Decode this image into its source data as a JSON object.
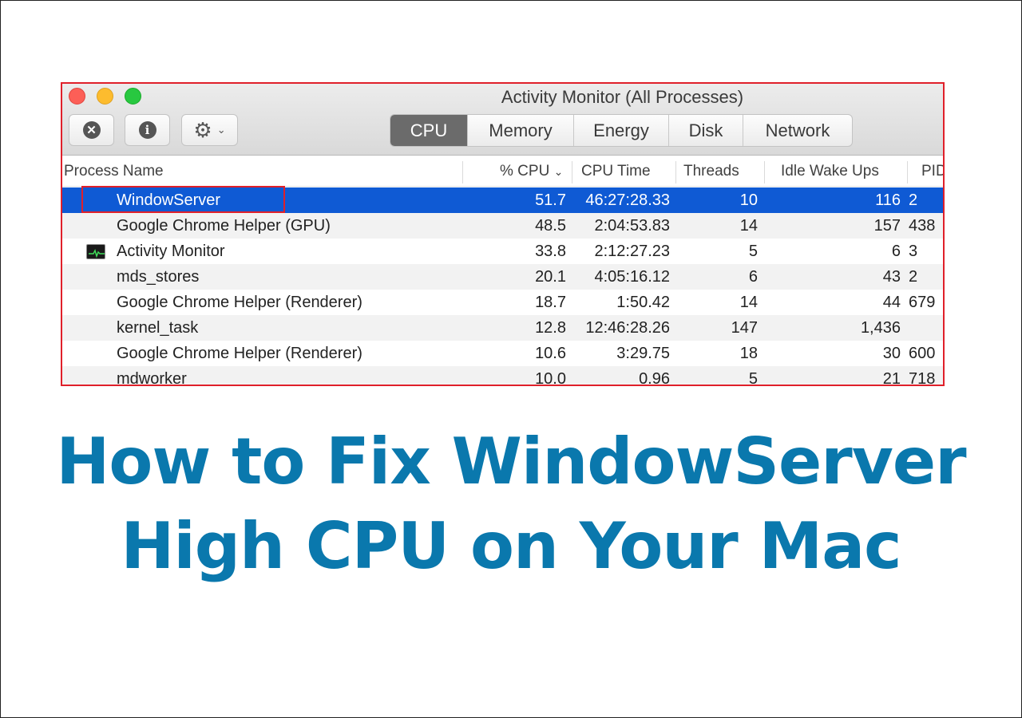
{
  "window": {
    "title": "Activity Monitor (All Processes)",
    "toolbar": {
      "stop_icon": "x-circle-icon",
      "info_icon": "info-icon",
      "gear_icon": "gear-icon",
      "tabs": [
        {
          "label": "CPU",
          "active": true
        },
        {
          "label": "Memory",
          "active": false
        },
        {
          "label": "Energy",
          "active": false
        },
        {
          "label": "Disk",
          "active": false
        },
        {
          "label": "Network",
          "active": false
        }
      ]
    },
    "columns": {
      "name": "Process Name",
      "cpu": "% CPU",
      "cpu_time": "CPU Time",
      "threads": "Threads",
      "idle": "Idle Wake Ups",
      "pid": "PID"
    },
    "rows": [
      {
        "name": "WindowServer",
        "cpu": "51.7",
        "time": "46:27:28.33",
        "threads": "10",
        "idle": "116",
        "pid": "2"
      },
      {
        "name": "Google Chrome Helper (GPU)",
        "cpu": "48.5",
        "time": "2:04:53.83",
        "threads": "14",
        "idle": "157",
        "pid": "438"
      },
      {
        "name": "Activity Monitor",
        "cpu": "33.8",
        "time": "2:12:27.23",
        "threads": "5",
        "idle": "6",
        "pid": "3"
      },
      {
        "name": "mds_stores",
        "cpu": "20.1",
        "time": "4:05:16.12",
        "threads": "6",
        "idle": "43",
        "pid": "2"
      },
      {
        "name": "Google Chrome Helper (Renderer)",
        "cpu": "18.7",
        "time": "1:50.42",
        "threads": "14",
        "idle": "44",
        "pid": "679"
      },
      {
        "name": "kernel_task",
        "cpu": "12.8",
        "time": "12:46:28.26",
        "threads": "147",
        "idle": "1,436",
        "pid": ""
      },
      {
        "name": "Google Chrome Helper (Renderer)",
        "cpu": "10.6",
        "time": "3:29.75",
        "threads": "18",
        "idle": "30",
        "pid": "600"
      },
      {
        "name": "mdworker",
        "cpu": "10.0",
        "time": "0.96",
        "threads": "5",
        "idle": "21",
        "pid": "718"
      }
    ],
    "selected_row": 0
  },
  "headline": {
    "line1": "How to Fix WindowServer",
    "line2": "High CPU on Your Mac"
  },
  "colors": {
    "highlight_border": "#e0202a",
    "selection": "#0f5ad4",
    "headline": "#0a78ad"
  }
}
